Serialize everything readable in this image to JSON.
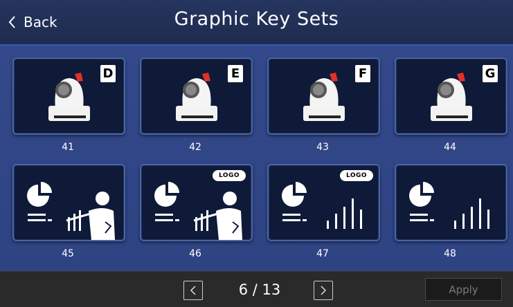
{
  "header": {
    "back_label": "Back",
    "title": "Graphic Key Sets"
  },
  "tiles": [
    {
      "number": "41",
      "icon": "ptz-camera-icon",
      "badge": "D"
    },
    {
      "number": "42",
      "icon": "ptz-camera-icon",
      "badge": "E"
    },
    {
      "number": "43",
      "icon": "ptz-camera-icon",
      "badge": "F"
    },
    {
      "number": "44",
      "icon": "ptz-camera-icon",
      "badge": "G"
    },
    {
      "number": "45",
      "icon": "presenter-chart-icon",
      "badge": ""
    },
    {
      "number": "46",
      "icon": "presenter-chart-icon",
      "badge": "LOGO"
    },
    {
      "number": "47",
      "icon": "bar-chart-icon",
      "badge": "LOGO"
    },
    {
      "number": "48",
      "icon": "bar-chart-icon",
      "badge": ""
    }
  ],
  "footer": {
    "page_indicator": "6 / 13",
    "apply_label": "Apply"
  },
  "colors": {
    "background": "#2f4684",
    "header": "#1e2b4f",
    "tile": "#0e1a37",
    "camera_accent": "#e0302a",
    "footer": "#2a2a2a"
  }
}
